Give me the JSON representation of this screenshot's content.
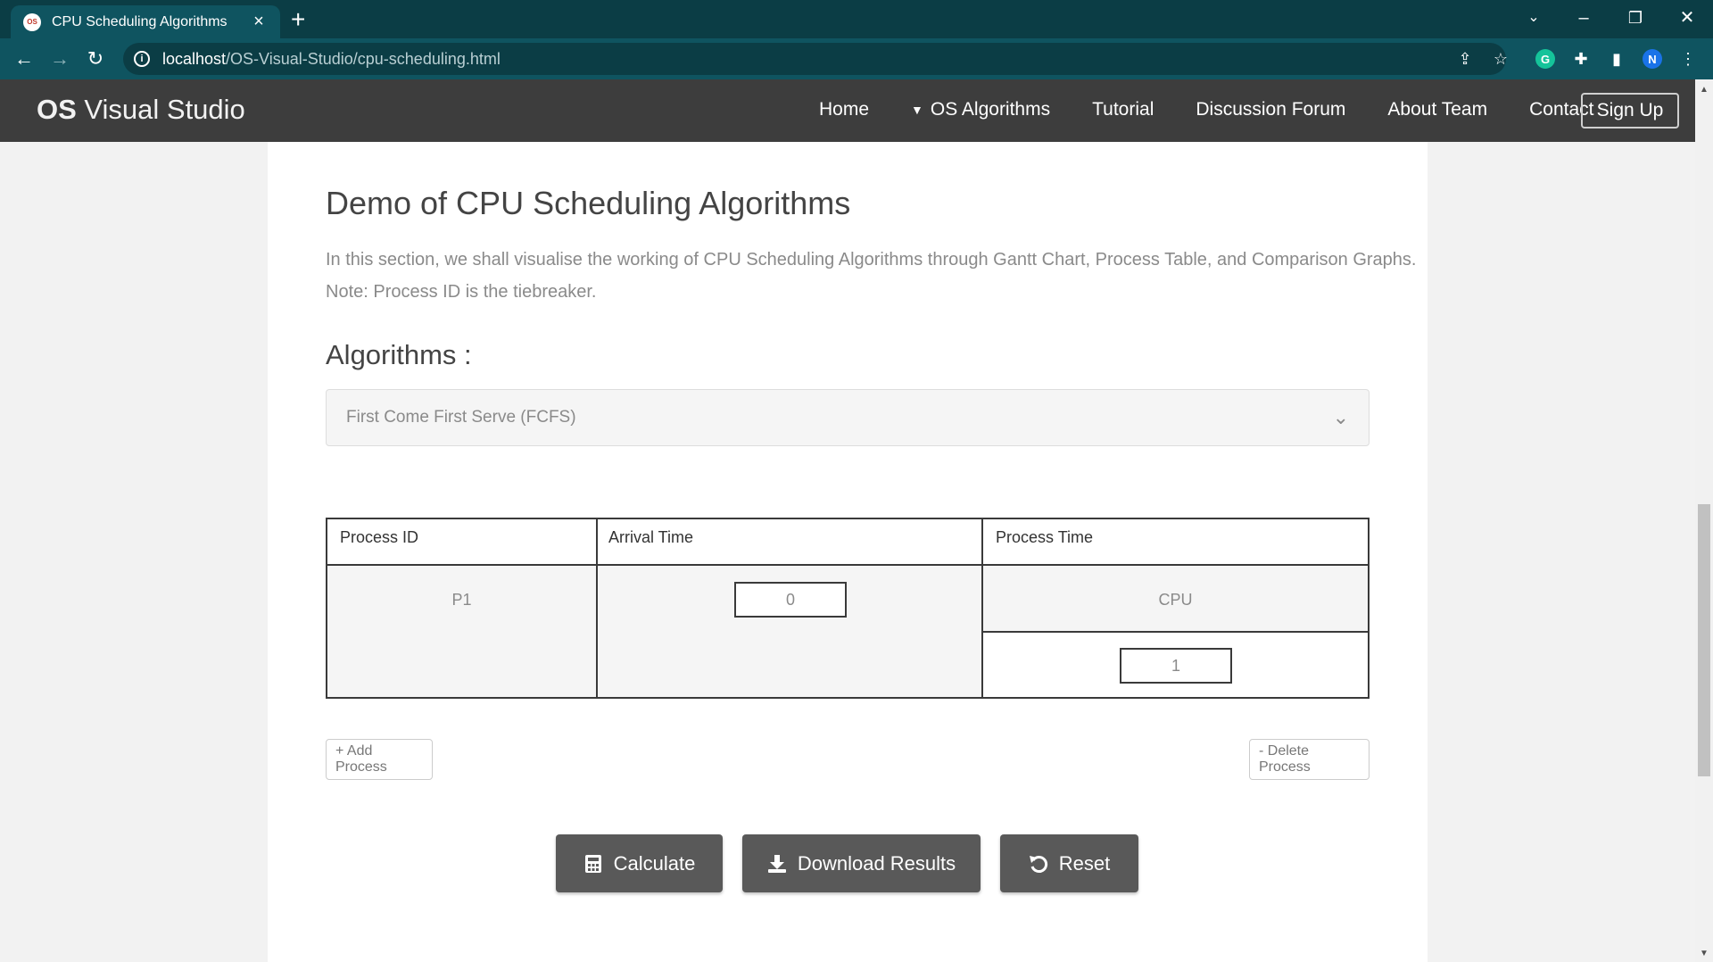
{
  "browser": {
    "tab_title": "CPU Scheduling Algorithms",
    "favicon_text": "OS",
    "url_host": "localhost",
    "url_path": "/OS-Visual-Studio/cpu-scheduling.html",
    "profile_initial": "N",
    "grammarly_letter": "G"
  },
  "navbar": {
    "brand_bold": "OS",
    "brand_rest": " Visual Studio",
    "links": [
      "Home",
      "OS Algorithms",
      "Tutorial",
      "Discussion Forum",
      "About Team",
      "Contact"
    ],
    "signup_label": "Sign Up"
  },
  "main": {
    "title": "Demo of CPU Scheduling Algorithms",
    "intro": "In this section, we shall visualise the working of CPU Scheduling Algorithms through Gantt Chart, Process Table, and Comparison Graphs.",
    "note": "Note: Process ID is the tiebreaker.",
    "algorithms_heading": "Algorithms :",
    "algorithm_selected": "First Come First Serve (FCFS)"
  },
  "table": {
    "headers": [
      "Process ID",
      "Arrival Time",
      "Process Time"
    ],
    "rows": [
      {
        "process_id": "P1",
        "arrival_time": "0",
        "burst_label": "CPU",
        "burst_time": "1"
      }
    ]
  },
  "buttons": {
    "add_process": "+ Add Process",
    "delete_process": "- Delete Process",
    "calculate": "Calculate",
    "download": "Download Results",
    "reset": "Reset"
  },
  "colors": {
    "browser_frame": "#0b3d45",
    "browser_toolbar": "#0f5460",
    "site_nav": "#3d3d3d",
    "action_button": "#595959"
  },
  "icons": {
    "calculate": "calculator-icon",
    "download": "download-icon",
    "reset": "undo-icon"
  }
}
